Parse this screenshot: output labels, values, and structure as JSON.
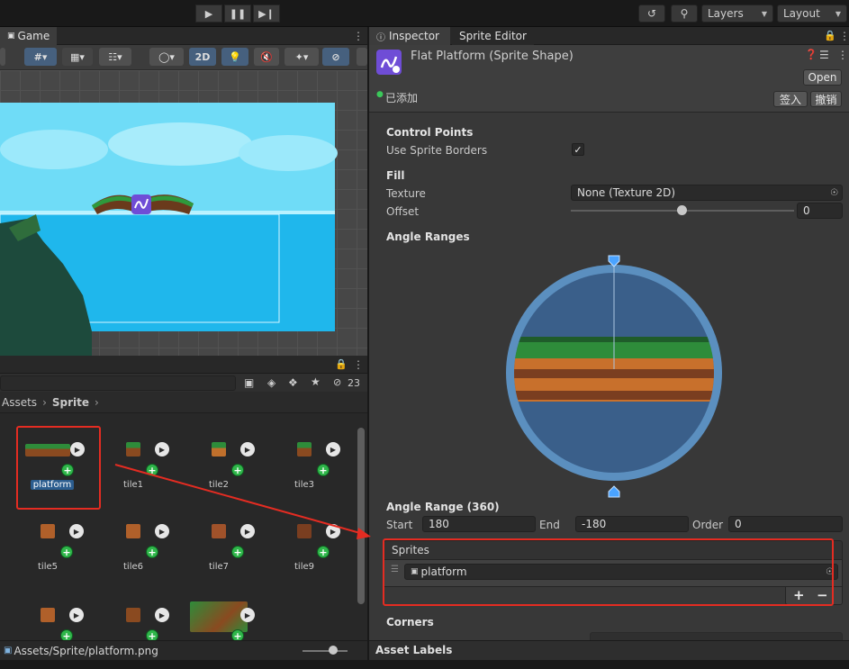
{
  "toolbar": {
    "play_icon": "play-icon",
    "pause_icon": "pause-icon",
    "step_icon": "step-icon",
    "layers_label": "Layers",
    "layout_label": "Layout"
  },
  "game": {
    "tab_label": "Game",
    "mode_2d": "2D"
  },
  "project": {
    "count": "23",
    "breadcrumb": [
      "Assets",
      "Sprite"
    ],
    "assets": [
      {
        "label": "platform",
        "selected": true
      },
      {
        "label": "tile1"
      },
      {
        "label": "tile2"
      },
      {
        "label": "tile3"
      },
      {
        "label": "tile5"
      },
      {
        "label": "tile6"
      },
      {
        "label": "tile7"
      },
      {
        "label": "tile9"
      },
      {
        "label": ""
      },
      {
        "label": ""
      },
      {
        "label": ""
      }
    ],
    "status_path": "Assets/Sprite/platform.png"
  },
  "inspector": {
    "tab_inspector": "Inspector",
    "tab_sprite_editor": "Sprite Editor",
    "object_title": "Flat Platform (Sprite Shape)",
    "open_button": "Open",
    "added_label": "已添加",
    "checkin_button": "签入",
    "revert_button": "撤销",
    "control_points": {
      "title": "Control Points",
      "use_sprite_borders_label": "Use Sprite Borders",
      "use_sprite_borders": true
    },
    "fill": {
      "title": "Fill",
      "texture_label": "Texture",
      "texture_value": "None (Texture 2D)",
      "offset_label": "Offset",
      "offset_value": "0"
    },
    "angle_ranges": {
      "title": "Angle Ranges",
      "range_title": "Angle Range (360)",
      "start_label": "Start",
      "start_value": "180",
      "end_label": "End",
      "end_value": "-180",
      "order_label": "Order",
      "order_value": "0"
    },
    "sprites": {
      "title": "Sprites",
      "item": "platform",
      "add": "+",
      "remove": "−"
    },
    "corners": {
      "title": "Corners"
    },
    "asset_labels": "Asset Labels"
  },
  "colors": {
    "accent_red": "#e42c22",
    "sky": "#2fc7f2",
    "circle_fill": "#3a5f8a",
    "circle_ring": "#5b8fbf",
    "toggle_blue": "#3d6ea8"
  }
}
